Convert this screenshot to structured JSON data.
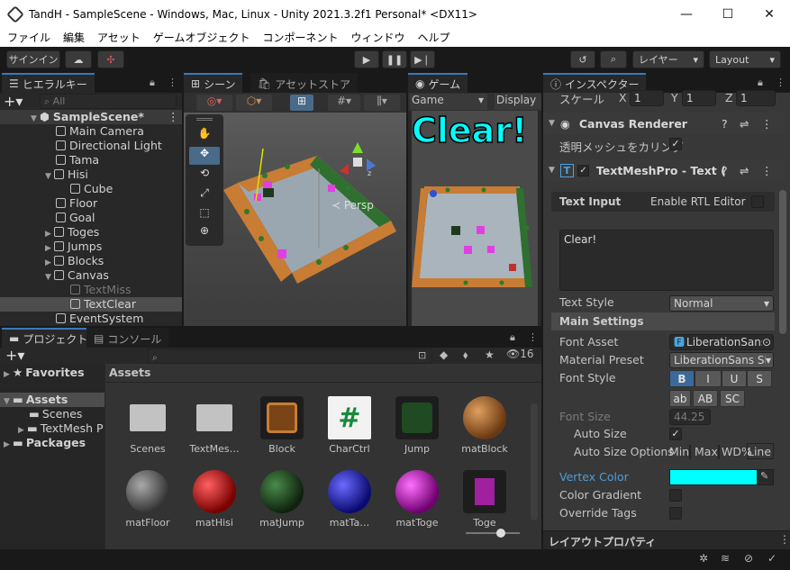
{
  "window": {
    "title": "TandH - SampleScene - Windows, Mac, Linux - Unity 2021.3.2f1 Personal* <DX11>",
    "minimize": "—",
    "maximize": "☐",
    "close": "✕"
  },
  "menu": [
    "ファイル",
    "編集",
    "アセット",
    "ゲームオブジェクト",
    "コンポーネント",
    "ウィンドウ",
    "ヘルプ"
  ],
  "toolbar": {
    "signin": "サインイン",
    "layer": "レイヤー",
    "layout": "Layout"
  },
  "hierarchy": {
    "tab": "ヒエラルキー",
    "search_placeholder": "All",
    "scene": "SampleScene*",
    "items": [
      {
        "label": "Main Camera"
      },
      {
        "label": "Directional Light"
      },
      {
        "label": "Tama"
      },
      {
        "label": "Hisi"
      },
      {
        "label": "Cube"
      },
      {
        "label": "Floor"
      },
      {
        "label": "Goal"
      },
      {
        "label": "Toges"
      },
      {
        "label": "Jumps"
      },
      {
        "label": "Blocks"
      },
      {
        "label": "Canvas"
      },
      {
        "label": "TextMiss"
      },
      {
        "label": "TextClear"
      },
      {
        "label": "EventSystem"
      }
    ]
  },
  "scene": {
    "tab_scene": "シーン",
    "tab_store": "アセットストア",
    "persp": "≺ Persp"
  },
  "game": {
    "tab": "ゲーム",
    "display_dropdown": "Game",
    "display": "Display",
    "clear_text": "Clear!"
  },
  "project": {
    "tab_project": "プロジェクト",
    "tab_console": "コンソール",
    "favorites": "Favorites",
    "assets_root": "Assets",
    "scenes": "Scenes",
    "textmesh": "TextMesh P",
    "packages": "Packages",
    "breadcrumb": "Assets",
    "hidden_count": "16",
    "assets": [
      {
        "name": "Scenes"
      },
      {
        "name": "TextMes…"
      },
      {
        "name": "Block"
      },
      {
        "name": "CharCtrl"
      },
      {
        "name": "Jump"
      },
      {
        "name": "matBlock"
      },
      {
        "name": "matFloor"
      },
      {
        "name": "matHisi"
      },
      {
        "name": "matJump"
      },
      {
        "name": "matTa…"
      },
      {
        "name": "matToge"
      },
      {
        "name": "Toge"
      }
    ]
  },
  "inspector": {
    "tab": "インスペクター",
    "scale_label": "スケール",
    "scale_x": "1",
    "scale_y": "1",
    "scale_z": "1",
    "canvas_renderer": "Canvas Renderer",
    "cull_transparent": "透明メッシュをカリング",
    "tmp_title": "TextMeshPro - Text (",
    "text_input": "Text Input",
    "enable_rtl": "Enable RTL Editor",
    "text_value": "Clear!",
    "text_style_label": "Text Style",
    "text_style_value": "Normal",
    "main_settings": "Main Settings",
    "font_asset_label": "Font Asset",
    "font_asset_value": "LiberationSans",
    "material_preset_label": "Material Preset",
    "material_preset_value": "LiberationSans SD",
    "font_style_label": "Font Style",
    "fs_b": "B",
    "fs_i": "I",
    "fs_u": "U",
    "fs_s": "S",
    "fs_ab": "ab",
    "fs_AB": "AB",
    "fs_sc": "SC",
    "font_size_label": "Font Size",
    "font_size_value": "44.25",
    "auto_size_label": "Auto Size",
    "auto_size_options_label": "Auto Size Options",
    "opt_min": "Min",
    "opt_max": "Max",
    "opt_wd": "WD%",
    "opt_line": "Line",
    "vertex_color_label": "Vertex Color",
    "vertex_color": "#00ffff",
    "color_gradient_label": "Color Gradient",
    "override_tags_label": "Override Tags",
    "layout_props": "レイアウトプロパティ"
  },
  "colors": {
    "accent": "#3a79bb",
    "clear_text": "#00ffff",
    "selection": "#2c5d87"
  }
}
